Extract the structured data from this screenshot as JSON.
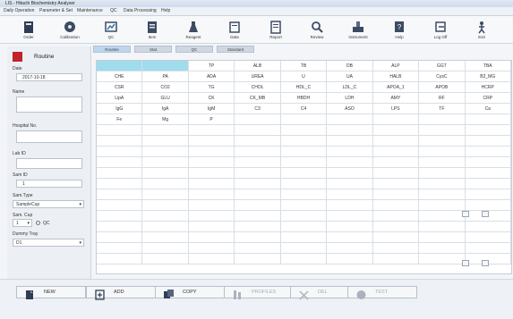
{
  "window": {
    "title": "LIS - Hitachi Biochemistry Analyser"
  },
  "menu": [
    "Daily Operation",
    "Parameter & Set",
    "Maintenance",
    "QC",
    "Data Processing",
    "Help"
  ],
  "toolbar": [
    {
      "label": "Order",
      "icon": "order-icon"
    },
    {
      "label": "Calibration",
      "icon": "calibration-icon"
    },
    {
      "label": "QC",
      "icon": "qc-icon"
    },
    {
      "label": "Item",
      "icon": "item-icon"
    },
    {
      "label": "Reagent",
      "icon": "reagent-icon"
    },
    {
      "label": "Data",
      "icon": "data-icon"
    },
    {
      "label": "Report",
      "icon": "report-icon"
    },
    {
      "label": "Review",
      "icon": "review-icon"
    },
    {
      "label": "Instrument",
      "icon": "instrument-icon"
    },
    {
      "label": "Help",
      "icon": "help-icon"
    },
    {
      "label": "Log Off",
      "icon": "logoff-icon"
    },
    {
      "label": "Exit",
      "icon": "exit-icon"
    }
  ],
  "left": {
    "mode": "Routine",
    "date_label": "Date",
    "date_value": "2017-10-18",
    "name_label": "Name",
    "hospital_label": "Hospital No.",
    "lab_label": "Lab ID",
    "sample_id_label": "Sam ID",
    "sample_id_value": "1",
    "sample_type_label": "Sam.Type",
    "sample_type_value": "SampleCup",
    "sample_cup_label": "Sam. Cup",
    "sample_cup_value": "1",
    "qc_label": "QC",
    "dummy_tray_label": "Dummy Tray",
    "dummy_tray_value": "D1"
  },
  "tabs": [
    "Routine",
    "Stat",
    "QC",
    "Standard"
  ],
  "grid_items": [
    [
      "",
      "",
      "TP",
      "ALB",
      "TB",
      "DB",
      "ALP",
      "GGT",
      "TBA"
    ],
    [
      "CHE",
      "PA",
      "ADA",
      "UREA",
      "U",
      "UA",
      "HALB",
      "CysC",
      "B2_MG"
    ],
    [
      "CSR",
      "CO2",
      "TG",
      "CHOL",
      "HDL_C",
      "LDL_C",
      "APOA_1",
      "APOB",
      "HCRP"
    ],
    [
      "LipA",
      "GLU",
      "CK",
      "CK_MB",
      "HBDH",
      "LDH",
      "AMY",
      "RF",
      "CRP"
    ],
    [
      "IgG",
      "IgA",
      "IgM",
      "C3",
      "C4",
      "ASO",
      "LPS",
      "TF",
      "Ca"
    ],
    [
      "Fe",
      "Mg",
      "P",
      "",
      "",
      "",
      "",
      "",
      ""
    ]
  ],
  "bottom_buttons": [
    {
      "label": "NEW",
      "icon": "new-icon",
      "enabled": true
    },
    {
      "label": "ADD",
      "icon": "add-icon",
      "enabled": true
    },
    {
      "label": "COPY",
      "icon": "copy-icon",
      "enabled": true
    },
    {
      "label": "PROFILES",
      "icon": "profiles-icon",
      "enabled": false
    },
    {
      "label": "DEL",
      "icon": "delete-icon",
      "enabled": false
    },
    {
      "label": "TEST",
      "icon": "test-icon",
      "enabled": false
    }
  ],
  "colors": {
    "selected_cell": "#9fdcec",
    "routine_indicator": "#c4222b",
    "active_tab": "#bcd7ee"
  }
}
